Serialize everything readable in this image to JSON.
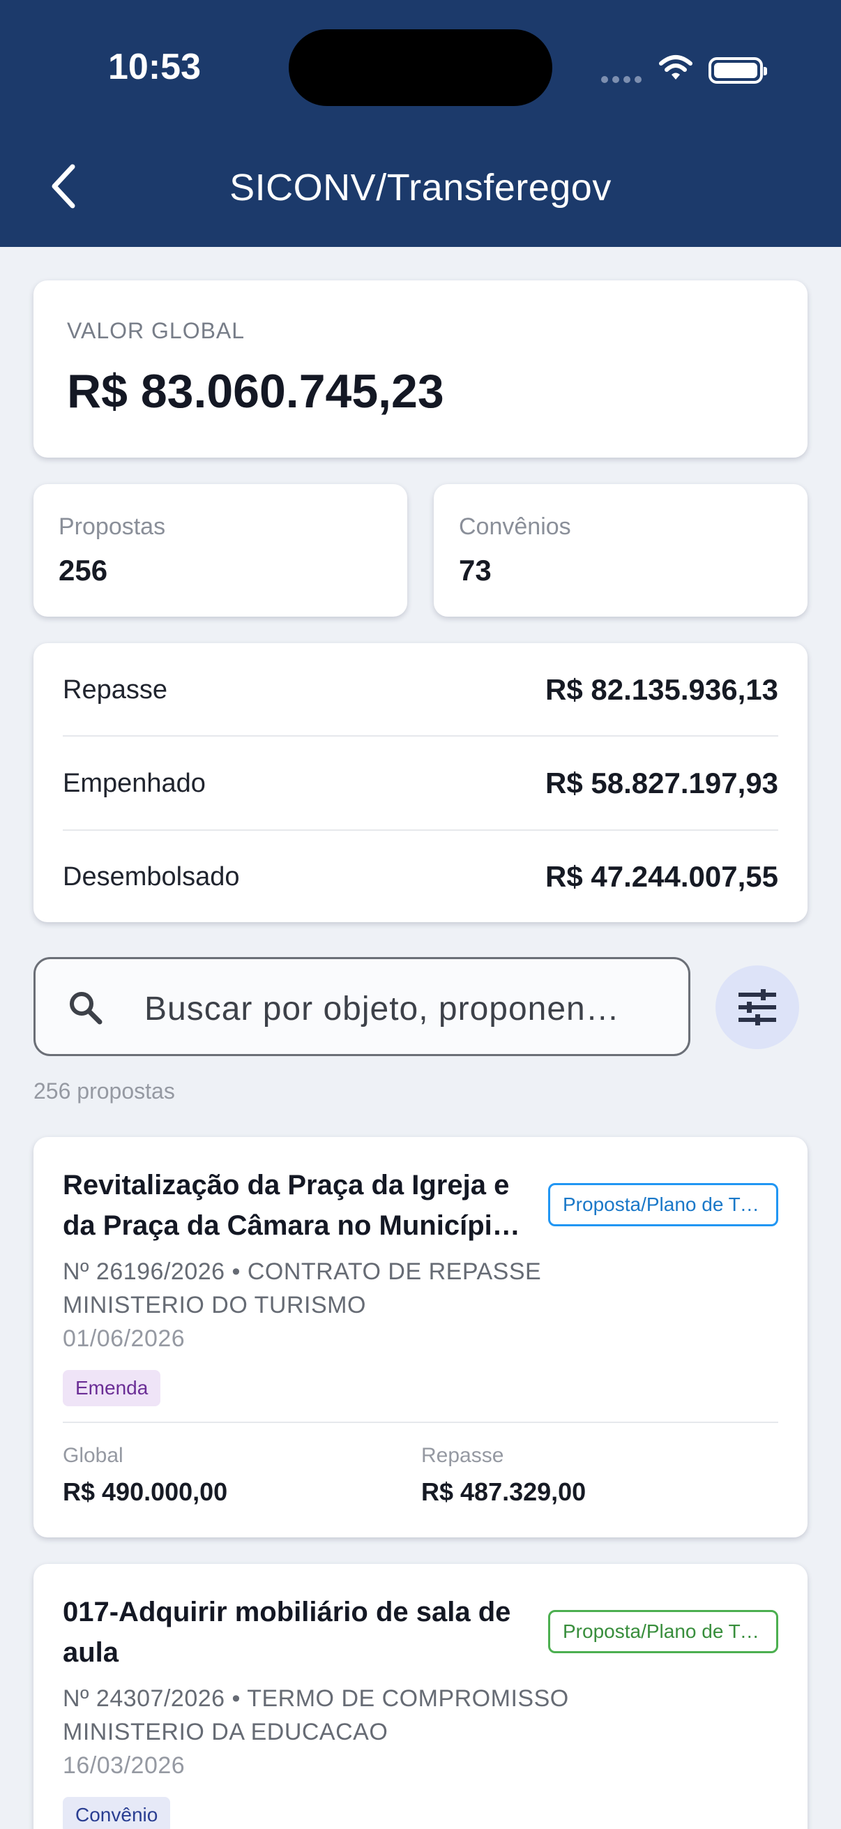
{
  "status_bar": {
    "time": "10:53"
  },
  "header": {
    "title": "SICONV/Transferegov",
    "back_icon": "chevron-left-icon"
  },
  "summary": {
    "global_label": "VALOR GLOBAL",
    "global_value": "R$ 83.060.745,23",
    "propostas_label": "Propostas",
    "propostas_value": "256",
    "convenios_label": "Convênios",
    "convenios_value": "73"
  },
  "values": [
    {
      "label": "Repasse",
      "value": "R$ 82.135.936,13"
    },
    {
      "label": "Empenhado",
      "value": "R$ 58.827.197,93"
    },
    {
      "label": "Desembolsado",
      "value": "R$ 47.244.007,55"
    }
  ],
  "search": {
    "placeholder": "Buscar por objeto, proponen…",
    "icon": "search-icon",
    "filter_icon": "tune-icon"
  },
  "results_count": "256 propostas",
  "items": [
    {
      "title": "Revitalização da Praça da Igreja e da Praça da Câmara no Município de S…",
      "status": "Proposta/Plano de Tr…",
      "number_line": "Nº 26196/2026 • CONTRATO DE REPASSE",
      "ministry": "MINISTERIO DO TURISMO",
      "date": "01/06/2026",
      "tag": "Emenda",
      "global_label": "Global",
      "global_value": "R$ 490.000,00",
      "repasse_label": "Repasse",
      "repasse_value": "R$ 487.329,00"
    },
    {
      "title": "017-Adquirir mobiliário de sala de aula",
      "status": "Proposta/Plano de Tr…",
      "number_line": "Nº 24307/2026 • TERMO DE COMPROMISSO",
      "ministry": "MINISTERIO DA EDUCACAO",
      "date": "16/03/2026",
      "tag": "Convênio"
    }
  ],
  "colors": {
    "header_bg": "#1c3a6b",
    "page_bg": "#eef1f6",
    "status_blue": "#2196f3",
    "status_green": "#4caf50",
    "tag_purple": "#6b2e96",
    "tag_indigo": "#2a3e92"
  }
}
